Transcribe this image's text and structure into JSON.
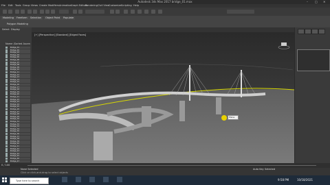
{
  "window": {
    "title": "Autodesk 3ds Max 2017   bridge_01.max",
    "minimize": "–",
    "maximize": "□",
    "close": "✕"
  },
  "menu": [
    "File",
    "Edit",
    "Tools",
    "Group",
    "Views",
    "Create",
    "Modifiers",
    "Animation",
    "Graph Editors",
    "Rendering",
    "Civil View",
    "Customize",
    "Scripting",
    "Help"
  ],
  "ribbon": {
    "tabs": [
      "Modeling",
      "Freeform",
      "Selection",
      "Object Paint",
      "Populate"
    ],
    "polygon_modeling": "Polygon Modeling"
  },
  "scene_explorer": {
    "tabs": [
      "Select",
      "Display"
    ],
    "header": "Name (Sorted Ascending)",
    "rows": [
      "Bridge_01",
      "Bridge_02",
      "Bridge_03",
      "Bridge_04",
      "Bridge_05",
      "Bridge_06",
      "Bridge_07",
      "Bridge_08",
      "Bridge_09",
      "Bridge_10",
      "Bridge_11",
      "Bridge_12",
      "Bridge_13",
      "Bridge_14",
      "Bridge_15",
      "Bridge_16",
      "Bridge_17",
      "Bridge_18",
      "Bridge_19",
      "Bridge_20",
      "Bridge_21",
      "Bridge_22",
      "Bridge_23",
      "Bridge_24",
      "Bridge_25",
      "Bridge_26",
      "Bridge_27",
      "Bridge_28",
      "Bridge_29",
      "Bridge_30",
      "Bridge_31",
      "Bridge_32",
      "Bridge_33",
      "Bridge_34",
      "Bridge_35",
      "Bridge_36",
      "Bridge_37",
      "Bridge_38",
      "Bridge_39",
      "Bridge_40",
      "Bridge_41",
      "Bridge_42",
      "Bridge_43",
      "Bridge_44",
      "Bridge_45",
      "Bridge_46",
      "Bridge_47"
    ]
  },
  "viewport": {
    "label": "[+] [Perspective] [Standard] [Edged Faces]",
    "tooltip": "Plane"
  },
  "timeline": {
    "frame": "0 / 100"
  },
  "status": {
    "selected": "None Selected",
    "hint": "Click or click-and-drag to select objects",
    "autokey": "Auto Key",
    "selected_label": "Selected"
  },
  "taskbar": {
    "search_placeholder": "Type here to search",
    "time": "9:58 PM",
    "date": "10/18/2021"
  },
  "colors": {
    "viewport_top": "#2e2e2e",
    "ground": "#6f6f6f",
    "accent": "#d9d900",
    "taskbar": "#1e2b3a"
  }
}
